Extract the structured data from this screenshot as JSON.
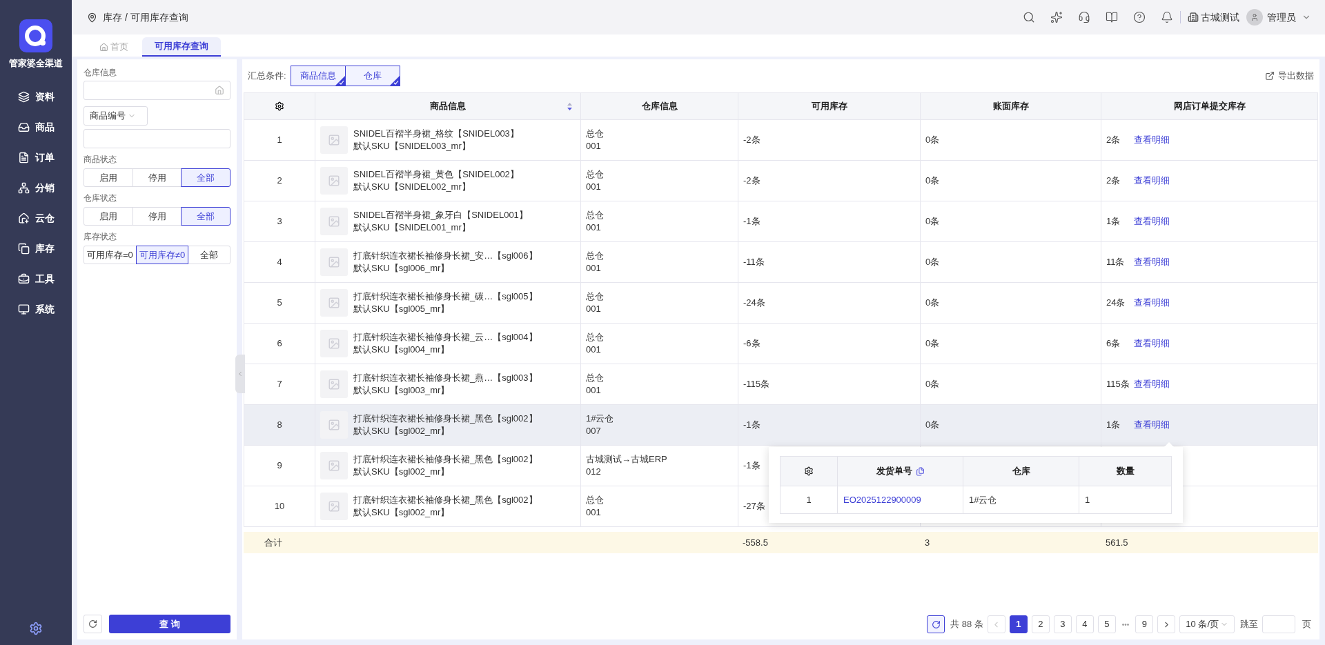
{
  "app": {
    "name": "管家婆全渠道"
  },
  "nav": [
    {
      "label": "资料"
    },
    {
      "label": "商品"
    },
    {
      "label": "订单"
    },
    {
      "label": "分销"
    },
    {
      "label": "云仓"
    },
    {
      "label": "库存"
    },
    {
      "label": "工具"
    },
    {
      "label": "系统"
    }
  ],
  "breadcrumb": "库存 / 可用库存查询",
  "header": {
    "company": "古城测试",
    "user": "管理员"
  },
  "tabs": [
    {
      "label": "首页",
      "selected": false
    },
    {
      "label": "可用库存查询",
      "selected": true
    }
  ],
  "filters": {
    "warehouse_label": "仓库信息",
    "code_select": "商品编号",
    "groups": [
      {
        "label": "商品状态",
        "options": [
          {
            "label": "启用",
            "selected": false
          },
          {
            "label": "停用",
            "selected": false
          },
          {
            "label": "全部",
            "selected": true
          }
        ]
      },
      {
        "label": "仓库状态",
        "options": [
          {
            "label": "启用",
            "selected": false
          },
          {
            "label": "停用",
            "selected": false
          },
          {
            "label": "全部",
            "selected": true
          }
        ]
      },
      {
        "label": "库存状态",
        "options": [
          {
            "label": "可用库存=0",
            "selected": false
          },
          {
            "label": "可用库存≠0",
            "selected": true
          },
          {
            "label": "全部",
            "selected": false
          }
        ]
      }
    ],
    "query_button": "查 询"
  },
  "summary": {
    "label": "汇总条件:",
    "options": [
      {
        "label": "商品信息",
        "selected": true
      },
      {
        "label": "仓库",
        "selected": true
      }
    ]
  },
  "export": "导出数据",
  "table": {
    "columns": [
      "商品信息",
      "仓库信息",
      "可用库存",
      "账面库存",
      "网店订单提交库存"
    ],
    "rows": [
      {
        "index": "1",
        "name": "SNIDEL百褶半身裙_格纹【SNIDEL003】",
        "sku": "默认SKU【SNIDEL003_mr】",
        "warehouse": "总仓",
        "warehouse_code": "001",
        "available": "-2条",
        "book": "0条",
        "online": "2条",
        "link": "查看明细",
        "highlighted": false
      },
      {
        "index": "2",
        "name": "SNIDEL百褶半身裙_黄色【SNIDEL002】",
        "sku": "默认SKU【SNIDEL002_mr】",
        "warehouse": "总仓",
        "warehouse_code": "001",
        "available": "-2条",
        "book": "0条",
        "online": "2条",
        "link": "查看明细",
        "highlighted": false
      },
      {
        "index": "3",
        "name": "SNIDEL百褶半身裙_象牙白【SNIDEL001】",
        "sku": "默认SKU【SNIDEL001_mr】",
        "warehouse": "总仓",
        "warehouse_code": "001",
        "available": "-1条",
        "book": "0条",
        "online": "1条",
        "link": "查看明细",
        "highlighted": false
      },
      {
        "index": "4",
        "name": "打底针织连衣裙长袖修身长裙_安…【sgl006】",
        "sku": "默认SKU【sgl006_mr】",
        "warehouse": "总仓",
        "warehouse_code": "001",
        "available": "-11条",
        "book": "0条",
        "online": "11条",
        "link": "查看明细",
        "highlighted": false
      },
      {
        "index": "5",
        "name": "打底针织连衣裙长袖修身长裙_碳…【sgl005】",
        "sku": "默认SKU【sgl005_mr】",
        "warehouse": "总仓",
        "warehouse_code": "001",
        "available": "-24条",
        "book": "0条",
        "online": "24条",
        "link": "查看明细",
        "highlighted": false
      },
      {
        "index": "6",
        "name": "打底针织连衣裙长袖修身长裙_云…【sgl004】",
        "sku": "默认SKU【sgl004_mr】",
        "warehouse": "总仓",
        "warehouse_code": "001",
        "available": "-6条",
        "book": "0条",
        "online": "6条",
        "link": "查看明细",
        "highlighted": false
      },
      {
        "index": "7",
        "name": "打底针织连衣裙长袖修身长裙_燕…【sgl003】",
        "sku": "默认SKU【sgl003_mr】",
        "warehouse": "总仓",
        "warehouse_code": "001",
        "available": "-115条",
        "book": "0条",
        "online": "115条",
        "link": "查看明细",
        "highlighted": false
      },
      {
        "index": "8",
        "name": "打底针织连衣裙长袖修身长裙_黑色【sgl002】",
        "sku": "默认SKU【sgl002_mr】",
        "warehouse": "1#云仓",
        "warehouse_code": "007",
        "available": "-1条",
        "book": "0条",
        "online": "1条",
        "link": "查看明细",
        "highlighted": true
      },
      {
        "index": "9",
        "name": "打底针织连衣裙长袖修身长裙_黑色【sgl002】",
        "sku": "默认SKU【sgl002_mr】",
        "warehouse": "古城测试→古城ERP",
        "warehouse_code": "012",
        "available": "-1条",
        "highlighted": false
      },
      {
        "index": "10",
        "name": "打底针织连衣裙长袖修身长裙_黑色【sgl002】",
        "sku": "默认SKU【sgl002_mr】",
        "warehouse": "总仓",
        "warehouse_code": "001",
        "available": "-27条",
        "highlighted": false
      }
    ],
    "total": {
      "label": "合计",
      "available": "-558.5",
      "book": "3",
      "online": "561.5"
    }
  },
  "popup": {
    "columns": [
      "发货单号",
      "仓库",
      "数量"
    ],
    "rows": [
      {
        "index": "1",
        "order": "EO2025122900009",
        "warehouse": "1#云仓",
        "quantity": "1"
      }
    ]
  },
  "pagination": {
    "total": "共 88 条",
    "pages": [
      {
        "kind": "page",
        "label": "1",
        "selected": true
      },
      {
        "kind": "page",
        "label": "2",
        "selected": false
      },
      {
        "kind": "page",
        "label": "3",
        "selected": false
      },
      {
        "kind": "page",
        "label": "4",
        "selected": false
      },
      {
        "kind": "page",
        "label": "5",
        "selected": false
      },
      {
        "kind": "ellipsis",
        "label": "•••",
        "selected": false
      },
      {
        "kind": "page",
        "label": "9",
        "selected": false
      }
    ],
    "page_size": "10 条/页",
    "jump": "跳至",
    "page_unit": "页"
  }
}
